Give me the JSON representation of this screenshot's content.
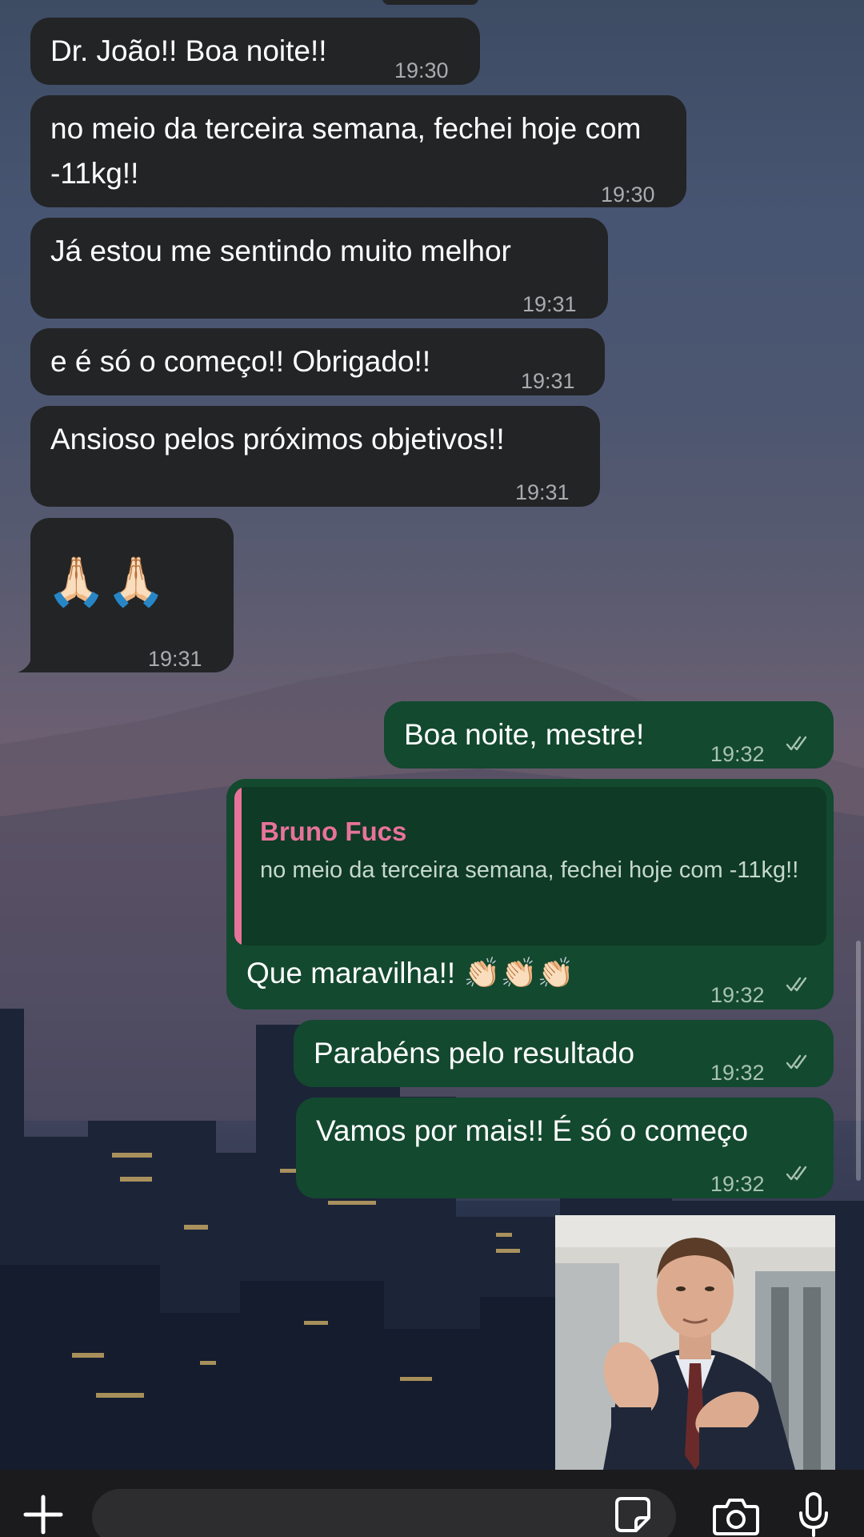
{
  "chat": {
    "messages": [
      {
        "direction": "incoming",
        "text": "Dr. João!! Boa noite!!",
        "time": "19:30"
      },
      {
        "direction": "incoming",
        "text": "no meio da terceira semana, fechei hoje com -11kg!!",
        "time": "19:30"
      },
      {
        "direction": "incoming",
        "text": "Já estou me sentindo muito melhor",
        "time": "19:31"
      },
      {
        "direction": "incoming",
        "text": "e é só o começo!! Obrigado!!",
        "time": "19:31"
      },
      {
        "direction": "incoming",
        "text": "Ansioso pelos próximos objetivos!!",
        "time": "19:31"
      },
      {
        "direction": "incoming",
        "text": "🙏🏻🙏🏻",
        "time": "19:31"
      },
      {
        "direction": "outgoing",
        "text": "Boa noite, mestre!",
        "time": "19:32",
        "status": "read"
      },
      {
        "direction": "outgoing",
        "text": "Que maravilha!! 👏🏻👏🏻👏🏻",
        "time": "19:32",
        "status": "read",
        "reply_to": {
          "author": "Bruno Fucs",
          "text": "no meio da terceira semana, fechei hoje com -11kg!!"
        }
      },
      {
        "direction": "outgoing",
        "text": "Parabéns pelo resultado",
        "time": "19:32",
        "status": "read"
      },
      {
        "direction": "outgoing",
        "text": "Vamos por mais!! É só o começo",
        "time": "19:32",
        "status": "read"
      },
      {
        "direction": "outgoing",
        "type": "gif",
        "content": "man-clapping-gif"
      }
    ]
  },
  "composer": {
    "icons": [
      "plus-icon",
      "sticker-icon",
      "camera-icon",
      "mic-icon"
    ]
  },
  "colors": {
    "incoming_bubble": "#232426",
    "outgoing_bubble": "#13492f",
    "quote_accent": "#e8739a",
    "timestamp": "#a9acae"
  }
}
